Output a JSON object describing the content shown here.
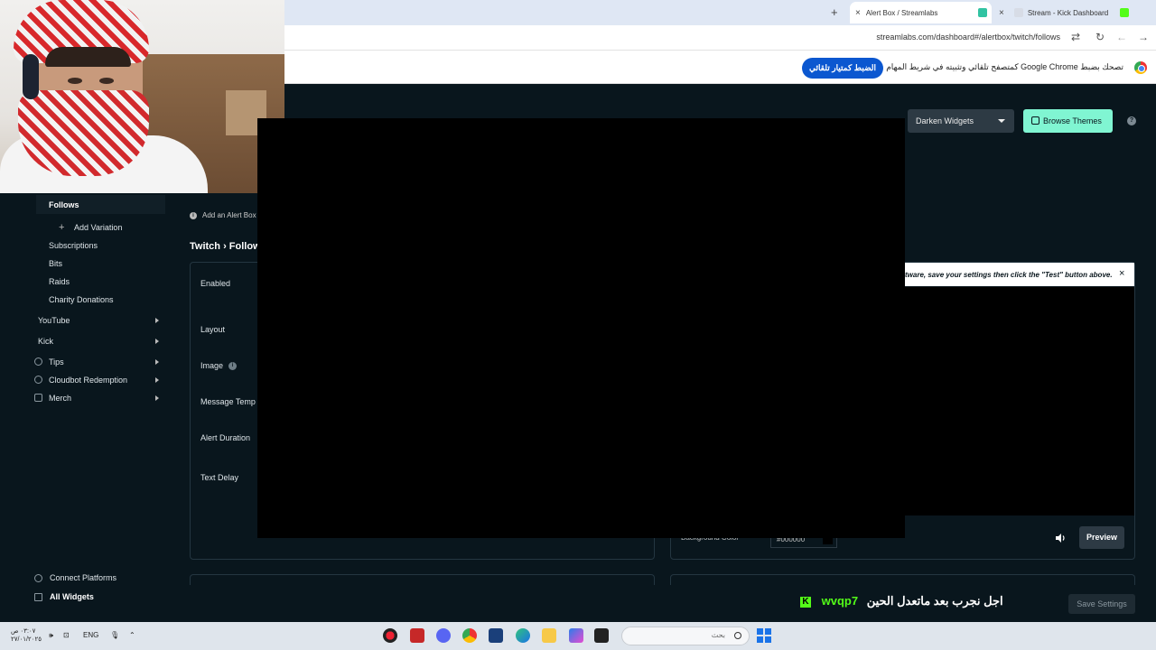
{
  "browser": {
    "tabs": [
      {
        "label": "Alert Box / Streamlabs",
        "active": true
      },
      {
        "label": "Stream - Kick Dashboard",
        "active": false
      }
    ],
    "new_tab_icon": "plus-icon",
    "url": "streamlabs.com/dashboard#/alertbox/twitch/follows"
  },
  "infobar": {
    "text": "تصحك بضبط Google Chrome كمتصفح تلقائي وتثبيته في شريط المهام",
    "button": "الضبط كمتيار تلقائي"
  },
  "toolbar": {
    "darken_label": "Darken Widgets",
    "browse_label": "Browse Themes",
    "help_icon": "?"
  },
  "sidebar": {
    "active_item": "Follows",
    "add_variation": "Add Variation",
    "items": [
      "Subscriptions",
      "Bits",
      "Raids",
      "Charity Donations"
    ],
    "groups": [
      "YouTube",
      "Kick",
      "Tips",
      "Cloudbot Redemption",
      "Merch"
    ],
    "connect_platforms": "Connect Platforms",
    "all_widgets": "All Widgets"
  },
  "content": {
    "add_alert": "Add an Alert Box",
    "info_glyph": "i",
    "breadcrumb": "Twitch › Follow",
    "fields": [
      "Enabled",
      "Layout",
      "Image",
      "Message Temp",
      "Alert Duration",
      "Text Delay"
    ],
    "notice": "tware, save your settings then click the \"Test\" button above.",
    "notice_close": "×",
    "bg_color_label": "Background Color",
    "bg_color_value": "#000000",
    "preview_label": "Preview",
    "save_label": "Save Settings"
  },
  "overlay": {
    "kick_badge": "K",
    "kick_user": "wvqp7",
    "kick_message": "اجل نجرب بعد ماتعدل الحين"
  },
  "taskbar": {
    "clock_time": "٠٣:٠٧ ص",
    "clock_date": "٢٧/٠١/٢٠٢٥",
    "lang": "ENG",
    "search_placeholder": "بحث"
  },
  "colors": {
    "app_bg": "#09161d",
    "accent": "#80f5d2",
    "kick_green": "#53fc18",
    "chrome_btn": "#0b57d0"
  }
}
